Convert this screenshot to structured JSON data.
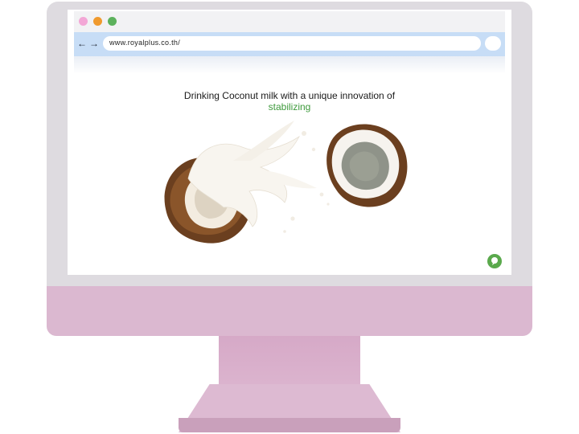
{
  "browser": {
    "window_controls": {
      "close_color": "#f3a7d6",
      "minimize_color": "#f09a2e",
      "maximize_color": "#5cb15c"
    },
    "nav": {
      "back_icon": "arrow-left-icon",
      "forward_icon": "arrow-right-icon"
    },
    "address": "www.royalplus.co.th/"
  },
  "page": {
    "headline": "Drinking Coconut milk with a unique innovation of",
    "headline_accent": "stabilizing",
    "accent_color": "#3e9a3c",
    "hero_image": "coconut-milk-splash-image",
    "chat_button_icon": "chat-icon"
  },
  "device": {
    "frame_color": "#dedbe0",
    "body_color": "#dbb8d0"
  }
}
